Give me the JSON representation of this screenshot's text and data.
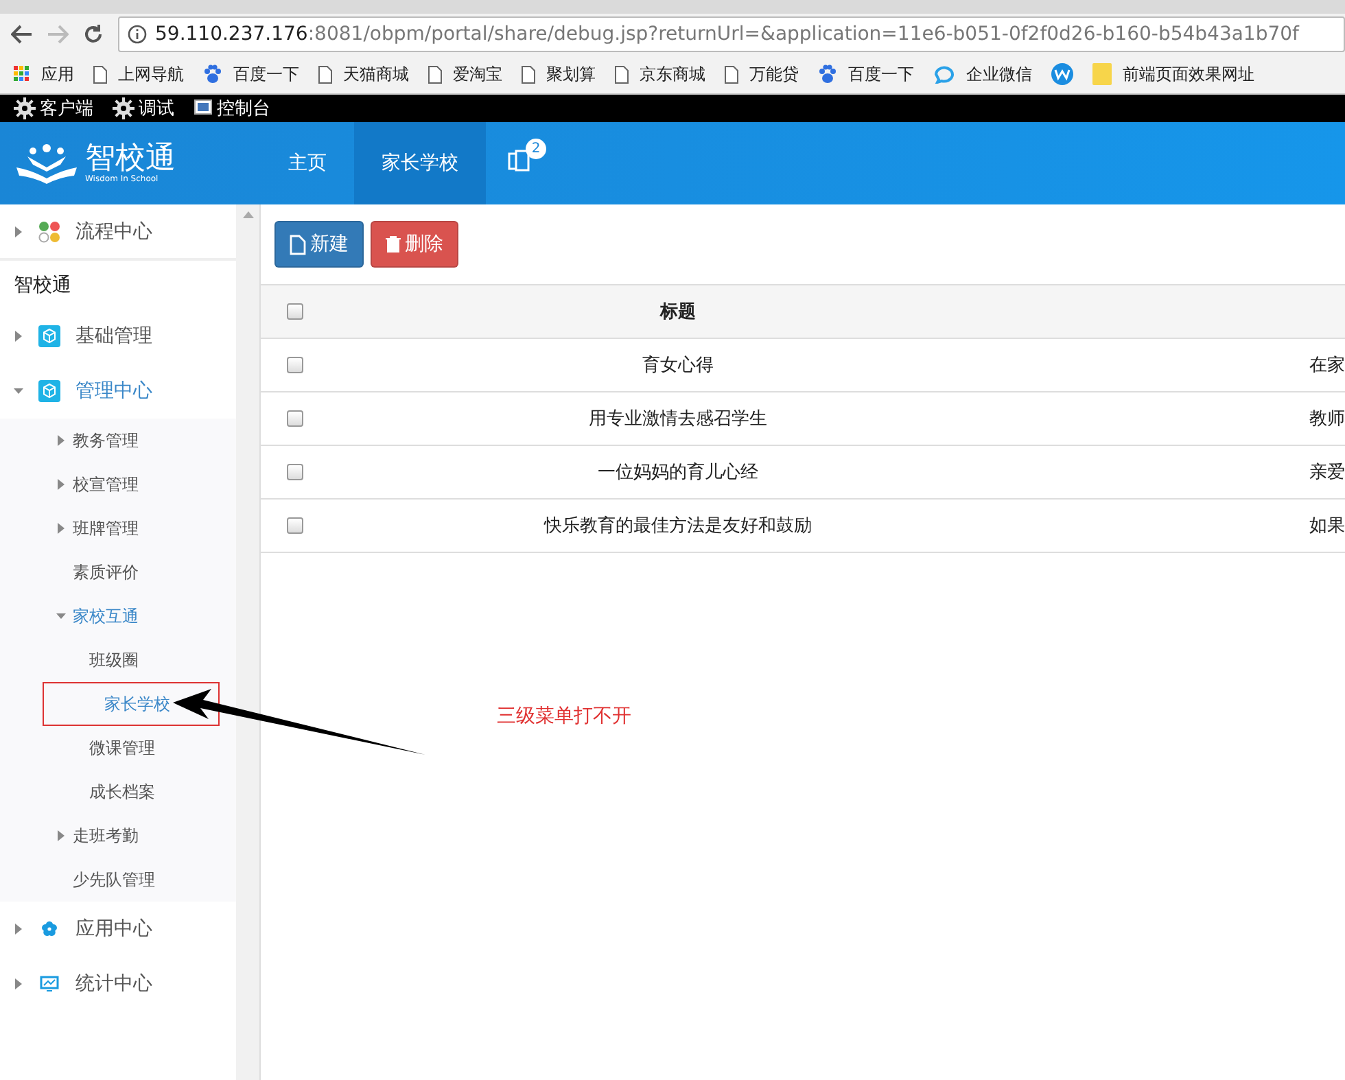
{
  "browser": {
    "url_host": "59.110.237.176",
    "url_rest": ":8081/obpm/portal/share/debug.jsp?returnUrl=&application=11e6-b051-0f2f0d26-b160-b54b43a1b70f",
    "bookmarks": [
      {
        "kind": "apps",
        "label": "应用"
      },
      {
        "kind": "page",
        "label": "上网导航"
      },
      {
        "kind": "paw",
        "label": "百度一下"
      },
      {
        "kind": "page",
        "label": "天猫商城"
      },
      {
        "kind": "page",
        "label": "爱淘宝"
      },
      {
        "kind": "page",
        "label": "聚划算"
      },
      {
        "kind": "page",
        "label": "京东商城"
      },
      {
        "kind": "page",
        "label": "万能贷"
      },
      {
        "kind": "paw",
        "label": "百度一下"
      },
      {
        "kind": "chat",
        "label": "企业微信"
      },
      {
        "kind": "w"
      },
      {
        "kind": "folder",
        "label": "前端页面效果网址"
      }
    ]
  },
  "devbar": [
    {
      "kind": "gear",
      "label": "客户端"
    },
    {
      "kind": "gear",
      "label": "调试"
    },
    {
      "kind": "monitor",
      "label": "控制台"
    }
  ],
  "header": {
    "logo": "智校通",
    "logo_sub": "Wisdom In School",
    "nav": [
      {
        "label": "主页",
        "selected": false
      },
      {
        "label": "家长学校",
        "selected": true
      }
    ],
    "badge": "2"
  },
  "sidebar": {
    "items": [
      {
        "kind": "group",
        "label": "流程中心",
        "expanded": false,
        "active": false
      },
      {
        "kind": "heading",
        "label": "智校通"
      },
      {
        "kind": "group",
        "label": "基础管理",
        "expanded": false,
        "active": false
      },
      {
        "kind": "group",
        "label": "管理中心",
        "expanded": true,
        "active": true,
        "children": [
          {
            "kind": "folder",
            "label": "教务管理",
            "expanded": false,
            "active": false
          },
          {
            "kind": "folder",
            "label": "校宣管理",
            "expanded": false,
            "active": false
          },
          {
            "kind": "folder",
            "label": "班牌管理",
            "expanded": false,
            "active": false
          },
          {
            "kind": "leaf",
            "label": "素质评价",
            "active": false
          },
          {
            "kind": "folder",
            "label": "家校互通",
            "expanded": true,
            "active": true,
            "children": [
              {
                "kind": "leaf",
                "label": "班级圈",
                "active": false
              },
              {
                "kind": "leaf",
                "label": "家长学校",
                "active": true,
                "marked": true
              },
              {
                "kind": "leaf",
                "label": "微课管理",
                "active": false
              },
              {
                "kind": "leaf",
                "label": "成长档案",
                "active": false
              }
            ]
          },
          {
            "kind": "folder",
            "label": "走班考勤",
            "expanded": false,
            "active": false
          },
          {
            "kind": "leaf",
            "label": "少先队管理",
            "active": false
          }
        ]
      },
      {
        "kind": "group",
        "label": "应用中心",
        "expanded": false,
        "active": false
      },
      {
        "kind": "group",
        "label": "统计中心",
        "expanded": false,
        "active": false
      }
    ]
  },
  "toolbar": [
    {
      "kind": "new",
      "label": "新建"
    },
    {
      "kind": "delete",
      "label": "删除"
    }
  ],
  "table": {
    "header": {
      "checked": false,
      "title": "标题"
    },
    "rows": [
      {
        "checked": false,
        "title": "育女心得",
        "column_2": "在家"
      },
      {
        "checked": false,
        "title": "用专业激情去感召学生",
        "column_2": "教师"
      },
      {
        "checked": false,
        "title": "一位妈妈的育儿心经",
        "column_2": "亲爱"
      },
      {
        "checked": false,
        "title": "快乐教育的最佳方法是友好和鼓励",
        "column_2": "如果"
      }
    ]
  },
  "annotation": {
    "text": "三级菜单打不开"
  }
}
